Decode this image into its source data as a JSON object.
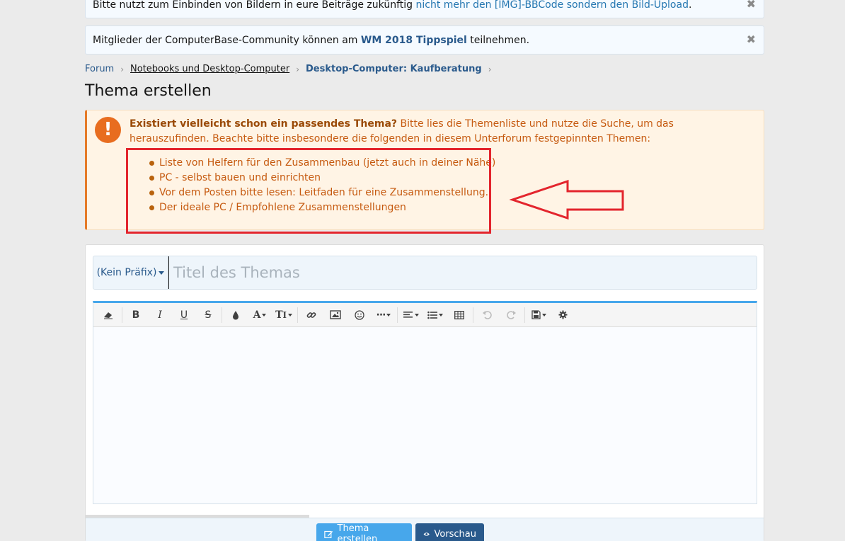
{
  "notices": [
    {
      "text_before": "Bitte nutzt zum Einbinden von Bildern in eure Beiträge zukünftig ",
      "link": "nicht mehr den [IMG]-BBCode sondern den Bild-Upload",
      "text_after": ".",
      "close": "✖"
    },
    {
      "text_before": "Mitglieder der ComputerBase-Community können am ",
      "link": "WM 2018 Tippspiel",
      "text_after": " teilnehmen.",
      "close": "✖"
    }
  ],
  "breadcrumb": [
    "Forum",
    "Notebooks und Desktop-Computer",
    "Desktop-Computer: Kaufberatung"
  ],
  "page_title": "Thema erstellen",
  "warning": {
    "icon": "!",
    "bold": "Existiert vielleicht schon ein passendes Thema?",
    "t1": " Bitte lies die ",
    "link1": "Themenliste",
    "t2": " und nutze die ",
    "link2": "Suche",
    "t3": ", um das herauszufinden. Beachte bitte insbesondere die folgenden in diesem Unterforum festgepinnten Themen:",
    "items": [
      "Liste von Helfern für den Zusammenbau (jetzt auch in deiner Nähe)",
      "PC - selbst bauen und einrichten",
      "Vor dem Posten bitte lesen: Leitfaden für eine Zusammenstellung.",
      "Der ideale PC / Empfohlene Zusammenstellungen"
    ]
  },
  "form": {
    "prefix": "(Kein Präfix)",
    "title_placeholder": "Titel des Themas",
    "toolbar_icons": [
      "eraser-icon",
      "bold-icon",
      "italic-icon",
      "underline-icon",
      "strikethrough-icon",
      "color-icon",
      "font-icon",
      "font-size-icon",
      "link-icon",
      "image-icon",
      "smiley-icon",
      "more-icon",
      "align-icon",
      "list-icon",
      "table-icon",
      "undo-icon",
      "redo-icon",
      "save-draft-icon",
      "settings-icon"
    ],
    "submit_label": "Thema erstellen",
    "preview_label": "Vorschau"
  },
  "colors": {
    "accent": "#47a7eb",
    "primary": "#2a5a8c",
    "warning": "#e86d1f",
    "highlight": "#e3252d"
  }
}
